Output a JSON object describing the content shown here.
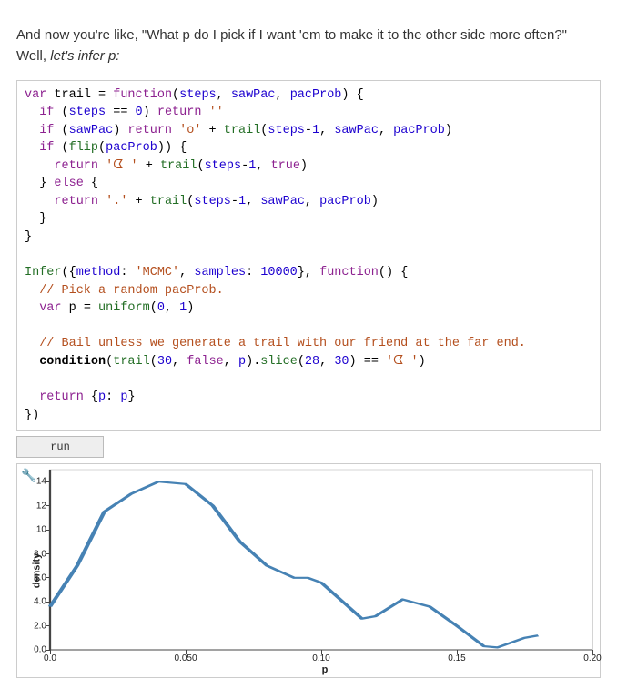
{
  "intro": {
    "t1": "And now you're like, \"What p do I pick if I want 'em to make it to the other side more often?\" Well, ",
    "t2": "let's infer p:"
  },
  "code": {
    "l1": {
      "a": "var",
      "b": " trail = ",
      "c": "function",
      "d": "(",
      "e": "steps",
      "f": ", ",
      "g": "sawPac",
      "h": ", ",
      "i": "pacProb",
      "j": ") {"
    },
    "l2": {
      "a": "  ",
      "b": "if",
      "c": " (",
      "d": "steps",
      "e": " == ",
      "f": "0",
      "g": ") ",
      "h": "return",
      "i": " ",
      "j": "''"
    },
    "l3": {
      "a": "  ",
      "b": "if",
      "c": " (",
      "d": "sawPac",
      "e": ") ",
      "f": "return",
      "g": " ",
      "h": "'o'",
      "i": " + ",
      "j": "trail",
      "k": "(",
      "l": "steps",
      "m": "-",
      "n": "1",
      "o": ", ",
      "p": "sawPac",
      "q": ", ",
      "r": "pacProb",
      "s": ")"
    },
    "l4": {
      "a": "  ",
      "b": "if",
      "c": " (",
      "d": "flip",
      "e": "(",
      "f": "pacProb",
      "g": ")) {"
    },
    "l5": {
      "a": "    ",
      "b": "return",
      "c": " ",
      "d": "'ᗧ '",
      "e": " + ",
      "f": "trail",
      "g": "(",
      "h": "steps",
      "i": "-",
      "j": "1",
      "k": ", ",
      "l": "true",
      "m": ")"
    },
    "l6": {
      "a": "  } ",
      "b": "else",
      "c": " {"
    },
    "l7": {
      "a": "    ",
      "b": "return",
      "c": " ",
      "d": "'.'",
      "e": " + ",
      "f": "trail",
      "g": "(",
      "h": "steps",
      "i": "-",
      "j": "1",
      "k": ", ",
      "l": "sawPac",
      "m": ", ",
      "n": "pacProb",
      "o": ")"
    },
    "l8": {
      "a": "  }"
    },
    "l9": {
      "a": "}"
    },
    "l10": {
      "a": ""
    },
    "l11": {
      "a": "Infer",
      "b": "({",
      "c": "method",
      "d": ": ",
      "e": "'MCMC'",
      "f": ", ",
      "g": "samples",
      "h": ": ",
      "i": "10000",
      "j": "}, ",
      "k": "function",
      "l": "() {"
    },
    "l12": {
      "a": "  ",
      "b": "// Pick a random pacProb."
    },
    "l13": {
      "a": "  ",
      "b": "var",
      "c": " p = ",
      "d": "uniform",
      "e": "(",
      "f": "0",
      "g": ", ",
      "h": "1",
      "i": ")"
    },
    "l14": {
      "a": ""
    },
    "l15": {
      "a": "  ",
      "b": "// Bail unless we generate a trail with our friend at the far end."
    },
    "l16": {
      "a": "  ",
      "b": "condition",
      "c": "(",
      "d": "trail",
      "e": "(",
      "f": "30",
      "g": ", ",
      "h": "false",
      "i": ", ",
      "j": "p",
      "k": ").",
      "l": "slice",
      "m": "(",
      "n": "28",
      "o": ", ",
      "p": "30",
      "q": ") == ",
      "r": "'ᗧ '",
      "s": ")"
    },
    "l17": {
      "a": ""
    },
    "l18": {
      "a": "  ",
      "b": "return",
      "c": " {",
      "d": "p",
      "e": ": ",
      "f": "p",
      "g": "}"
    },
    "l19": {
      "a": "})"
    }
  },
  "run": {
    "label": "run"
  },
  "chart": {
    "ylabel": "density",
    "xlabel": "p",
    "yticks_labels": [
      "0.0",
      "2.0",
      "4.0",
      "6.0",
      "8.0",
      "10",
      "12",
      "14"
    ],
    "xticks_labels": [
      "0.0",
      "0.050",
      "0.10",
      "0.15",
      "0.20"
    ]
  },
  "chart_data": {
    "type": "line",
    "title": "",
    "xlabel": "p",
    "ylabel": "density",
    "xlim": [
      0.0,
      0.2
    ],
    "ylim": [
      0.0,
      15.0
    ],
    "yticks": [
      0,
      2,
      4,
      6,
      8,
      10,
      12,
      14
    ],
    "xticks": [
      0.0,
      0.05,
      0.1,
      0.15,
      0.2
    ],
    "series": [
      {
        "name": "density",
        "x": [
          0.0,
          0.01,
          0.02,
          0.03,
          0.04,
          0.05,
          0.06,
          0.07,
          0.08,
          0.09,
          0.095,
          0.1,
          0.11,
          0.115,
          0.12,
          0.13,
          0.14,
          0.15,
          0.16,
          0.165,
          0.175,
          0.18
        ],
        "y": [
          3.6,
          7.0,
          11.5,
          13.0,
          14.0,
          13.8,
          12.0,
          9.0,
          7.0,
          6.0,
          6.0,
          5.6,
          3.6,
          2.6,
          2.8,
          4.2,
          3.6,
          2.0,
          0.3,
          0.2,
          1.0,
          1.2
        ]
      }
    ]
  }
}
